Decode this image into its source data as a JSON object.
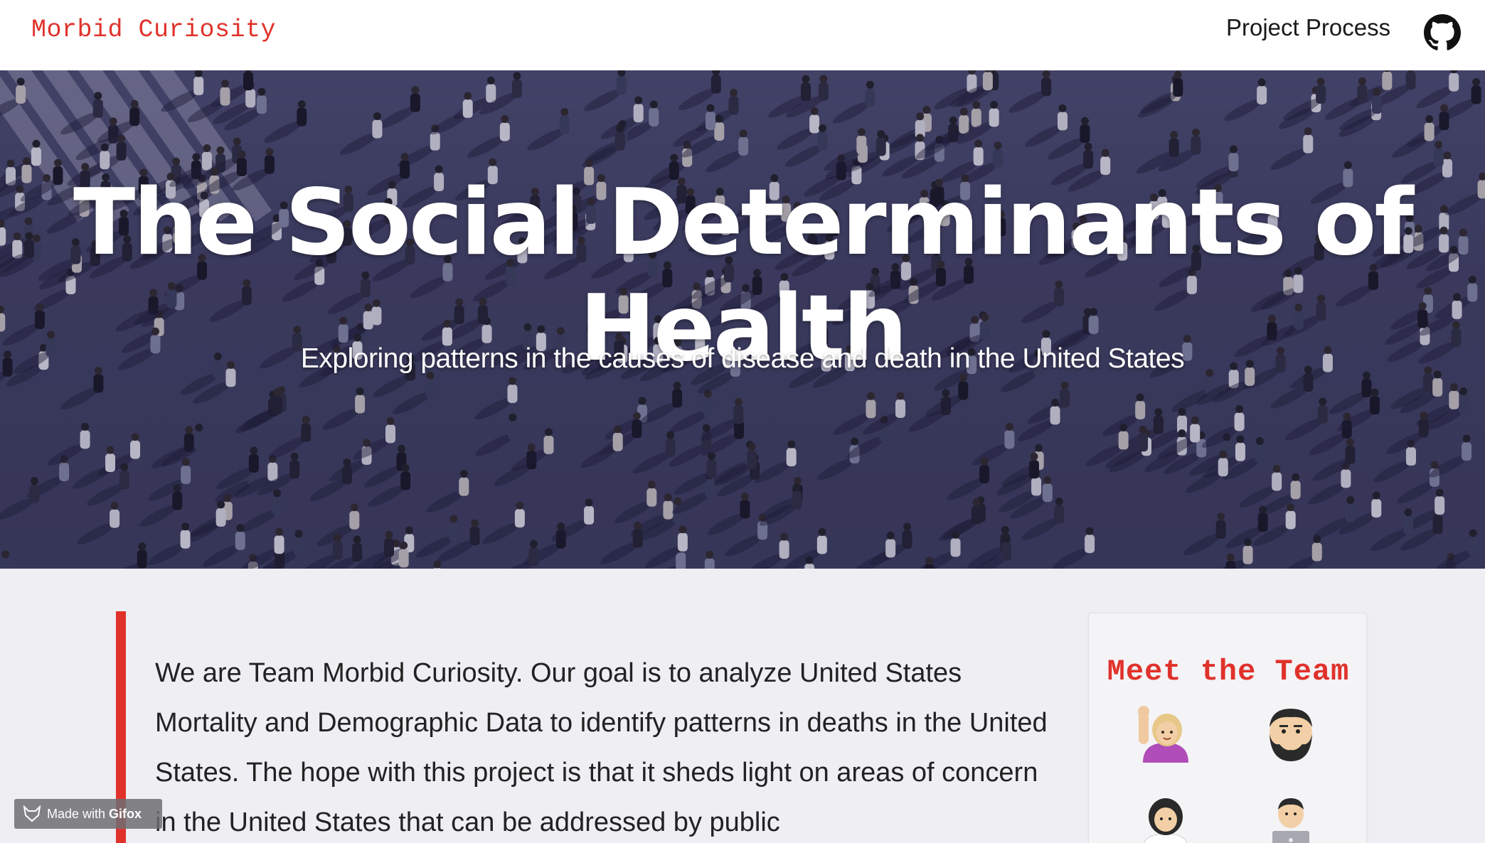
{
  "nav": {
    "brand": "Morbid Curiosity",
    "link_label": "Project Process",
    "github_icon": "github-icon"
  },
  "hero": {
    "title": "The Social Determinants of Health",
    "subtitle": "Exploring patterns in the causes of disease and death in the United States"
  },
  "intro": {
    "text": "We are Team Morbid Curiosity. Our goal is to analyze United States Mortality and Demographic Data to identify patterns in deaths in the United States. The hope with this project is that it sheds light on areas of concern in the United States that can be addressed by public"
  },
  "team": {
    "title": "Meet the Team",
    "members": [
      {
        "icon": "woman-raising-hand-icon"
      },
      {
        "icon": "bearded-man-icon"
      },
      {
        "icon": "woman-health-worker-icon"
      },
      {
        "icon": "man-technologist-icon"
      }
    ]
  },
  "badge": {
    "prefix": "Made with ",
    "name": "Gifox"
  },
  "colors": {
    "accent": "#e0322b",
    "background": "#efeef2",
    "nav_bg": "#ffffff"
  }
}
